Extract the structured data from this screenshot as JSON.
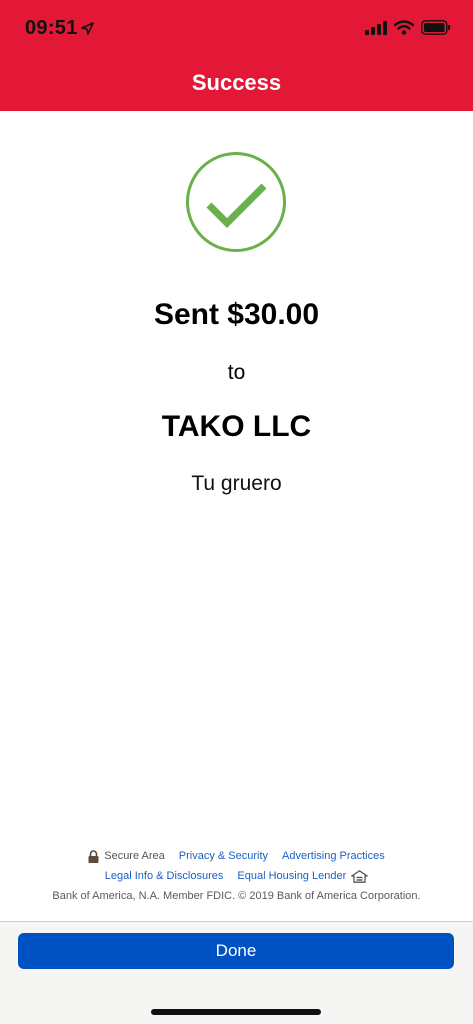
{
  "status_bar": {
    "time": "09:51",
    "icons": [
      "location-arrow-icon",
      "signal-icon",
      "wifi-icon",
      "battery-icon"
    ]
  },
  "header": {
    "title": "Success",
    "brand_color": "#e31837"
  },
  "confirmation": {
    "icon": "checkmark-circle-icon",
    "icon_color": "#6ab04c",
    "amount_text": "Sent $30.00",
    "to_text": "to",
    "recipient": "TAKO LLC",
    "memo": "Tu gruero"
  },
  "footer": {
    "secure_area": "Secure Area",
    "privacy_security": "Privacy & Security",
    "advertising_practices": "Advertising Practices",
    "legal_info": "Legal Info & Disclosures",
    "equal_housing": "Equal Housing Lender",
    "copyright": "Bank of America, N.A. Member FDIC. © 2019 Bank of America Corporation."
  },
  "actions": {
    "done_label": "Done",
    "button_color": "#0052c2"
  }
}
